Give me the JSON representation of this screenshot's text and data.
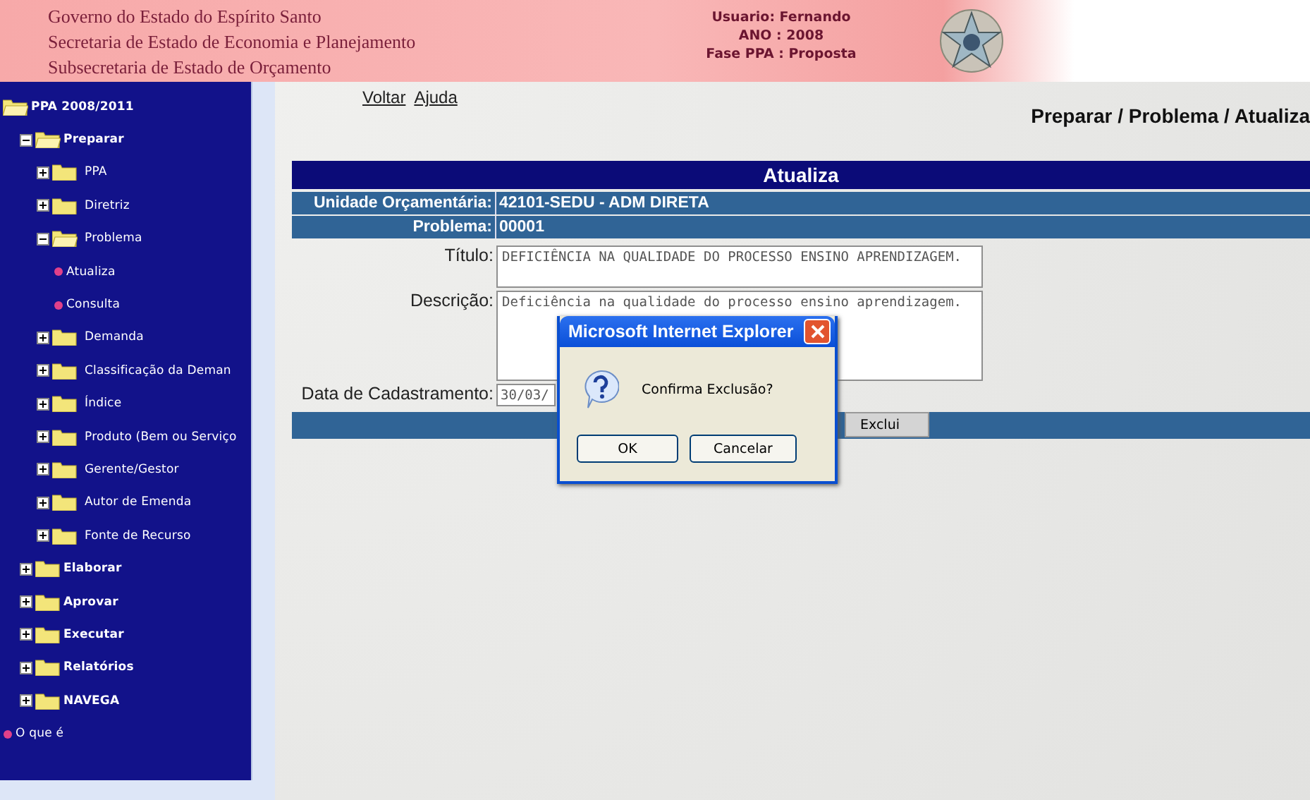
{
  "header": {
    "org_lines": [
      "Governo do Estado do Espírito Santo",
      "Secretaria de Estado de Economia e Planejamento",
      "Subsecretaria de Estado de Orçamento"
    ],
    "info": [
      "Usuario: Fernando",
      "ANO : 2008",
      "Fase PPA : Proposta"
    ]
  },
  "sidebar": {
    "tree": [
      {
        "label": "PPA 2008/2011",
        "kind": "folder",
        "expanded": true,
        "children": [
          {
            "label": "Preparar",
            "kind": "folder",
            "expanded": true,
            "children": [
              {
                "label": "PPA",
                "kind": "folder",
                "expanded": false
              },
              {
                "label": "Diretriz",
                "kind": "folder",
                "expanded": false
              },
              {
                "label": "Problema",
                "kind": "folder",
                "expanded": true,
                "children": [
                  {
                    "label": "Atualiza",
                    "kind": "leaf"
                  },
                  {
                    "label": "Consulta",
                    "kind": "leaf"
                  }
                ]
              },
              {
                "label": "Demanda",
                "kind": "folder",
                "expanded": false
              },
              {
                "label": "Classificação da Deman",
                "kind": "folder",
                "expanded": false
              },
              {
                "label": "Índice",
                "kind": "folder",
                "expanded": false
              },
              {
                "label": "Produto (Bem ou Serviço",
                "kind": "folder",
                "expanded": false
              },
              {
                "label": "Gerente/Gestor",
                "kind": "folder",
                "expanded": false
              },
              {
                "label": "Autor de Emenda",
                "kind": "folder",
                "expanded": false
              },
              {
                "label": "Fonte de Recurso",
                "kind": "folder",
                "expanded": false
              }
            ]
          },
          {
            "label": "Elaborar",
            "kind": "folder",
            "expanded": false
          },
          {
            "label": "Aprovar",
            "kind": "folder",
            "expanded": false
          },
          {
            "label": "Executar",
            "kind": "folder",
            "expanded": false
          },
          {
            "label": "Relatórios",
            "kind": "folder",
            "expanded": false
          },
          {
            "label": "NAVEGA",
            "kind": "folder",
            "expanded": false
          }
        ]
      },
      {
        "label": "O que é",
        "kind": "leaf"
      }
    ]
  },
  "links": [
    "Voltar",
    "Ajuda"
  ],
  "breadcrumb": "Preparar / Problema / Atualiza",
  "form": {
    "title": "Atualiza",
    "info_rows": [
      {
        "label": "Unidade Orçamentária:",
        "value": "42101-SEDU - ADM DIRETA"
      },
      {
        "label": "Problema:",
        "value": "00001"
      }
    ],
    "titulo": {
      "label": "Título:",
      "value": "DEFICIÊNCIA NA QUALIDADE DO PROCESSO ENSINO APRENDIZAGEM."
    },
    "descricao": {
      "label": "Descrição:",
      "value": "Deficiência na qualidade do processo ensino aprendizagem."
    },
    "data": {
      "label": "Data de Cadastramento:",
      "value": "30/03/"
    },
    "button": "Exclui"
  },
  "dialog": {
    "title": "Microsoft Internet Explorer",
    "message": "Confirma Exclusão?",
    "buttons": [
      "OK",
      "Cancelar"
    ]
  }
}
